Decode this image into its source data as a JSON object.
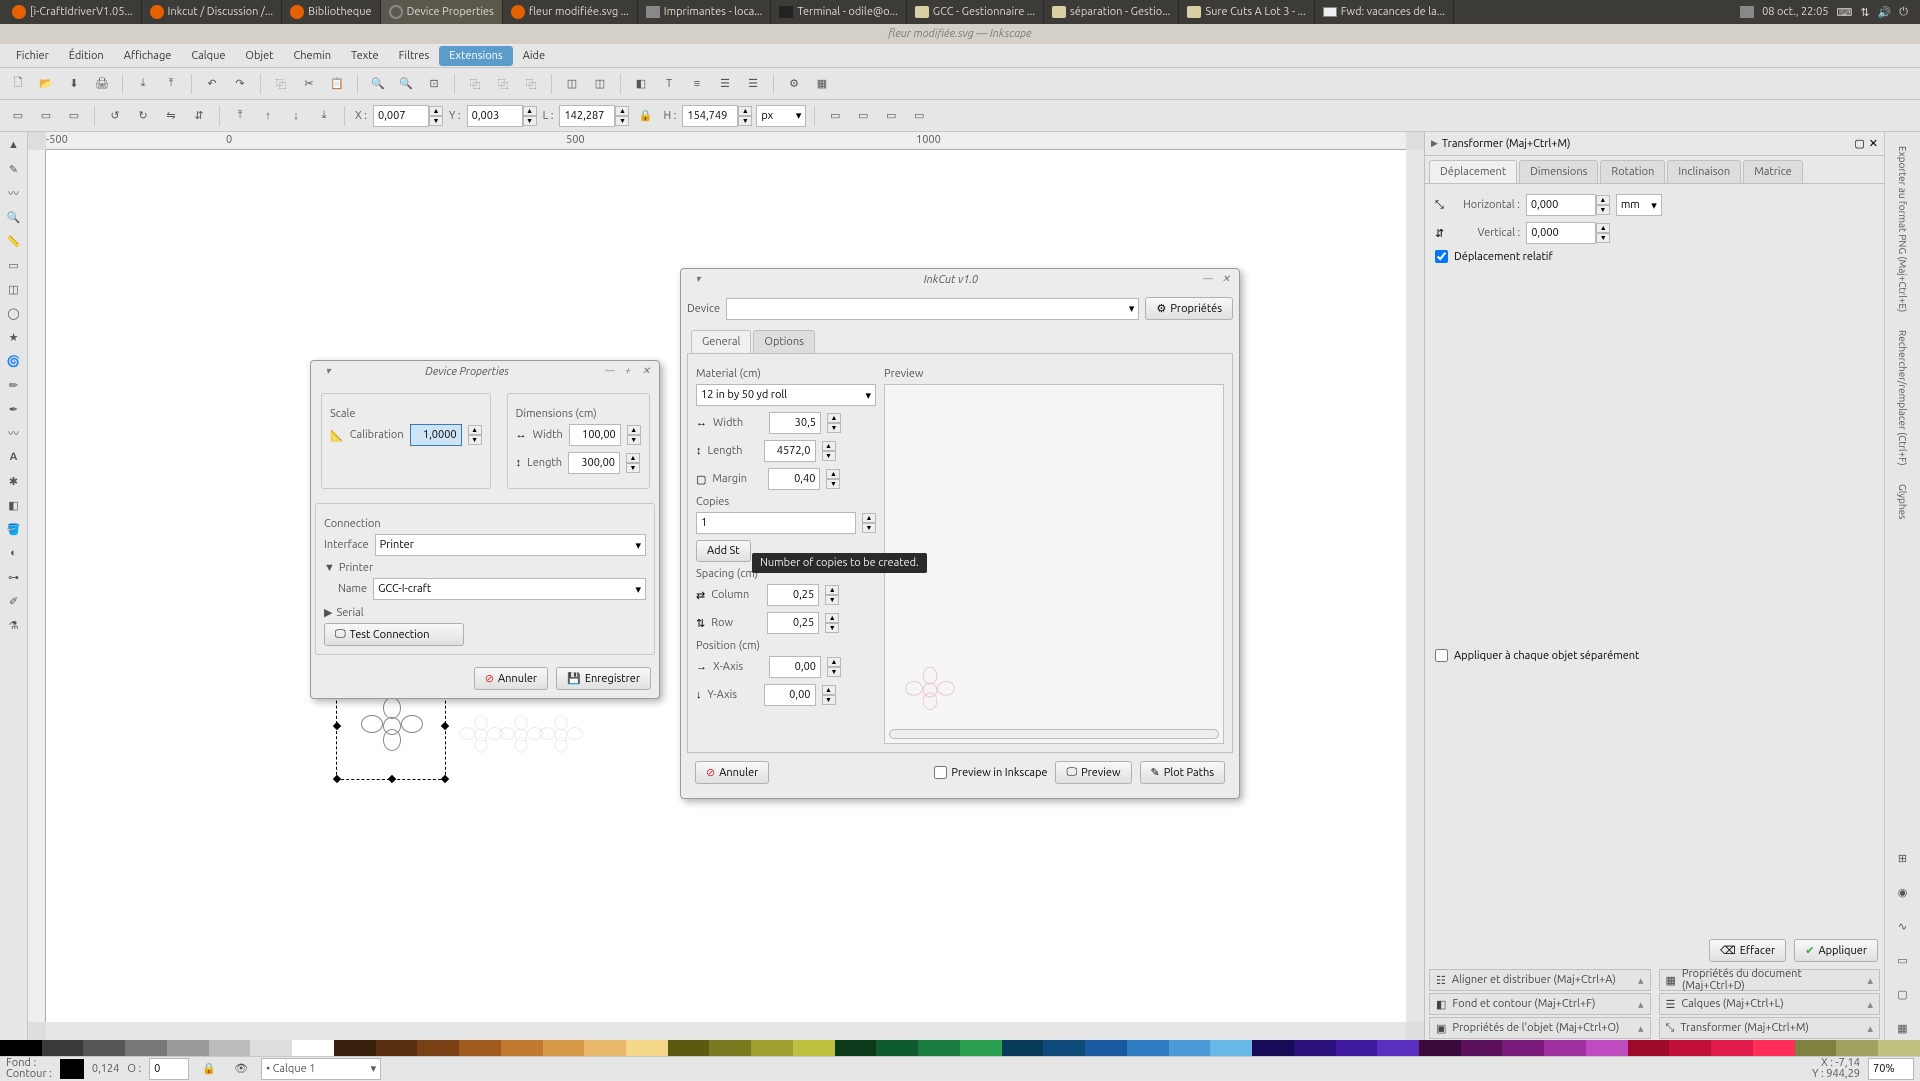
{
  "sysbar": {
    "tasks": [
      {
        "label": "[i-CraftIdriverV1.05..."
      },
      {
        "label": "Inkcut / Discussion /..."
      },
      {
        "label": "Bibliotheque"
      },
      {
        "label": "Device Properties",
        "active": true
      },
      {
        "label": "fleur modifiée.svg ..."
      },
      {
        "label": "Imprimantes - loca..."
      },
      {
        "label": "Terminal - odile@o..."
      },
      {
        "label": "GCC - Gestionnaire ..."
      },
      {
        "label": "séparation - Gestio..."
      },
      {
        "label": "Sure Cuts A Lot 3 - ..."
      },
      {
        "label": "Fwd: vacances de la..."
      }
    ],
    "clock": "08 oct., 22:05"
  },
  "appTitle": "fleur modifiée.svg — Inkscape",
  "menu": [
    "Fichier",
    "Édition",
    "Affichage",
    "Calque",
    "Objet",
    "Chemin",
    "Texte",
    "Filtres",
    "Extensions",
    "Aide"
  ],
  "menu_active": "Extensions",
  "toolbar2": {
    "x": "0,007",
    "y": "0,003",
    "w": "142,287",
    "h": "154,749",
    "units": "px"
  },
  "ruler_marks": [
    "-500",
    "0",
    "500",
    "1000"
  ],
  "transformer": {
    "title": "Transformer (Maj+Ctrl+M)",
    "tabs": [
      "Déplacement",
      "Dimensions",
      "Rotation",
      "Inclinaison",
      "Matrice"
    ],
    "tab_active": "Déplacement",
    "horizontal_label": "Horizontal :",
    "horizontal": "0,000",
    "vertical_label": "Vertical :",
    "vertical": "0,000",
    "unit": "mm",
    "relative": "Déplacement relatif",
    "apply_each": "Appliquer à chaque objet séparément",
    "clear": "Effacer",
    "apply": "Appliquer",
    "collapsed": [
      "Aligner et distribuer (Maj+Ctrl+A)",
      "Propriétés du document (Maj+Ctrl+D)",
      "Fond et contour (Maj+Ctrl+F)",
      "Calques (Maj+Ctrl+L)",
      "Propriétés de l'objet (Maj+Ctrl+O)",
      "Transformer (Maj+Ctrl+M)"
    ]
  },
  "rightTabs": [
    "Exporter au format PNG (Maj+Ctrl+E)",
    "Rechercher/remplacer (Ctrl+F)",
    "Glyphes"
  ],
  "deviceProps": {
    "title": "Device Properties",
    "scale": "Scale",
    "calibration_label": "Calibration",
    "calibration": "1,0000",
    "dimensions": "Dimensions (cm)",
    "width_label": "Width",
    "width": "100,00",
    "length_label": "Length",
    "length": "300,00",
    "connection": "Connection",
    "interface_label": "Interface",
    "interface": "Printer",
    "printer_header": "Printer",
    "name_label": "Name",
    "name": "GCC-I-craft",
    "serial_header": "Serial",
    "test": "Test Connection",
    "cancel": "Annuler",
    "save": "Enregistrer"
  },
  "inkcut": {
    "title": "InkCut v1.0",
    "device_label": "Device",
    "properties": "Propriétés",
    "tabs": [
      "General",
      "Options"
    ],
    "tab_active": "General",
    "material": "Material (cm)",
    "roll": "12 in by 50 yd roll",
    "width_label": "Width",
    "width": "30,5",
    "length_label": "Length",
    "length": "4572,0",
    "margin_label": "Margin",
    "margin": "0,40",
    "copies": "Copies",
    "copies_val": "1",
    "add_st": "Add St",
    "spacing": "Spacing (cm)",
    "column_label": "Column",
    "column": "0,25",
    "row_label": "Row",
    "row": "0,25",
    "position": "Position (cm)",
    "xaxis_label": "X-Axis",
    "xaxis": "0,00",
    "yaxis_label": "Y-Axis",
    "yaxis": "0,00",
    "preview_label": "Preview",
    "cancel": "Annuler",
    "preview_inkscape": "Preview in Inkscape",
    "preview": "Preview",
    "plot": "Plot Paths"
  },
  "tooltip": "Number of copies to be created.",
  "status": {
    "fond": "Fond :",
    "contour": "Contour :",
    "contour_val": "0,124",
    "o_label": "O :",
    "o_val": "0",
    "layer": "Calque 1",
    "x": "X :",
    "xval": "-7,14",
    "y": "Y :",
    "yval": "944,29",
    "zoom": "70%"
  },
  "palette_colors": [
    "#000",
    "#3a3a3a",
    "#555",
    "#777",
    "#999",
    "#bbb",
    "#ddd",
    "#fff",
    "#3a1f0b",
    "#5a2f10",
    "#7a4015",
    "#a05a1f",
    "#c07a2f",
    "#d89a4a",
    "#e8b86a",
    "#f5d78a",
    "#5a5a10",
    "#7a7a20",
    "#a0a030",
    "#c0c040",
    "#0a3a1a",
    "#105a2f",
    "#1a7a40",
    "#2aa050",
    "#0a3a5a",
    "#104a7a",
    "#1a5aa0",
    "#2f7ac0",
    "#4a9ad8",
    "#6ab8e8",
    "#1a0a5a",
    "#2a107a",
    "#3f1aa0",
    "#5a2fc0",
    "#3a0a3a",
    "#5a105a",
    "#7a1a7a",
    "#a02fa0",
    "#c04ac0",
    "#a00a2a",
    "#c0103a",
    "#e01a4a",
    "#ff2f5a",
    "#808040",
    "#a0a060",
    "#c0c080"
  ]
}
